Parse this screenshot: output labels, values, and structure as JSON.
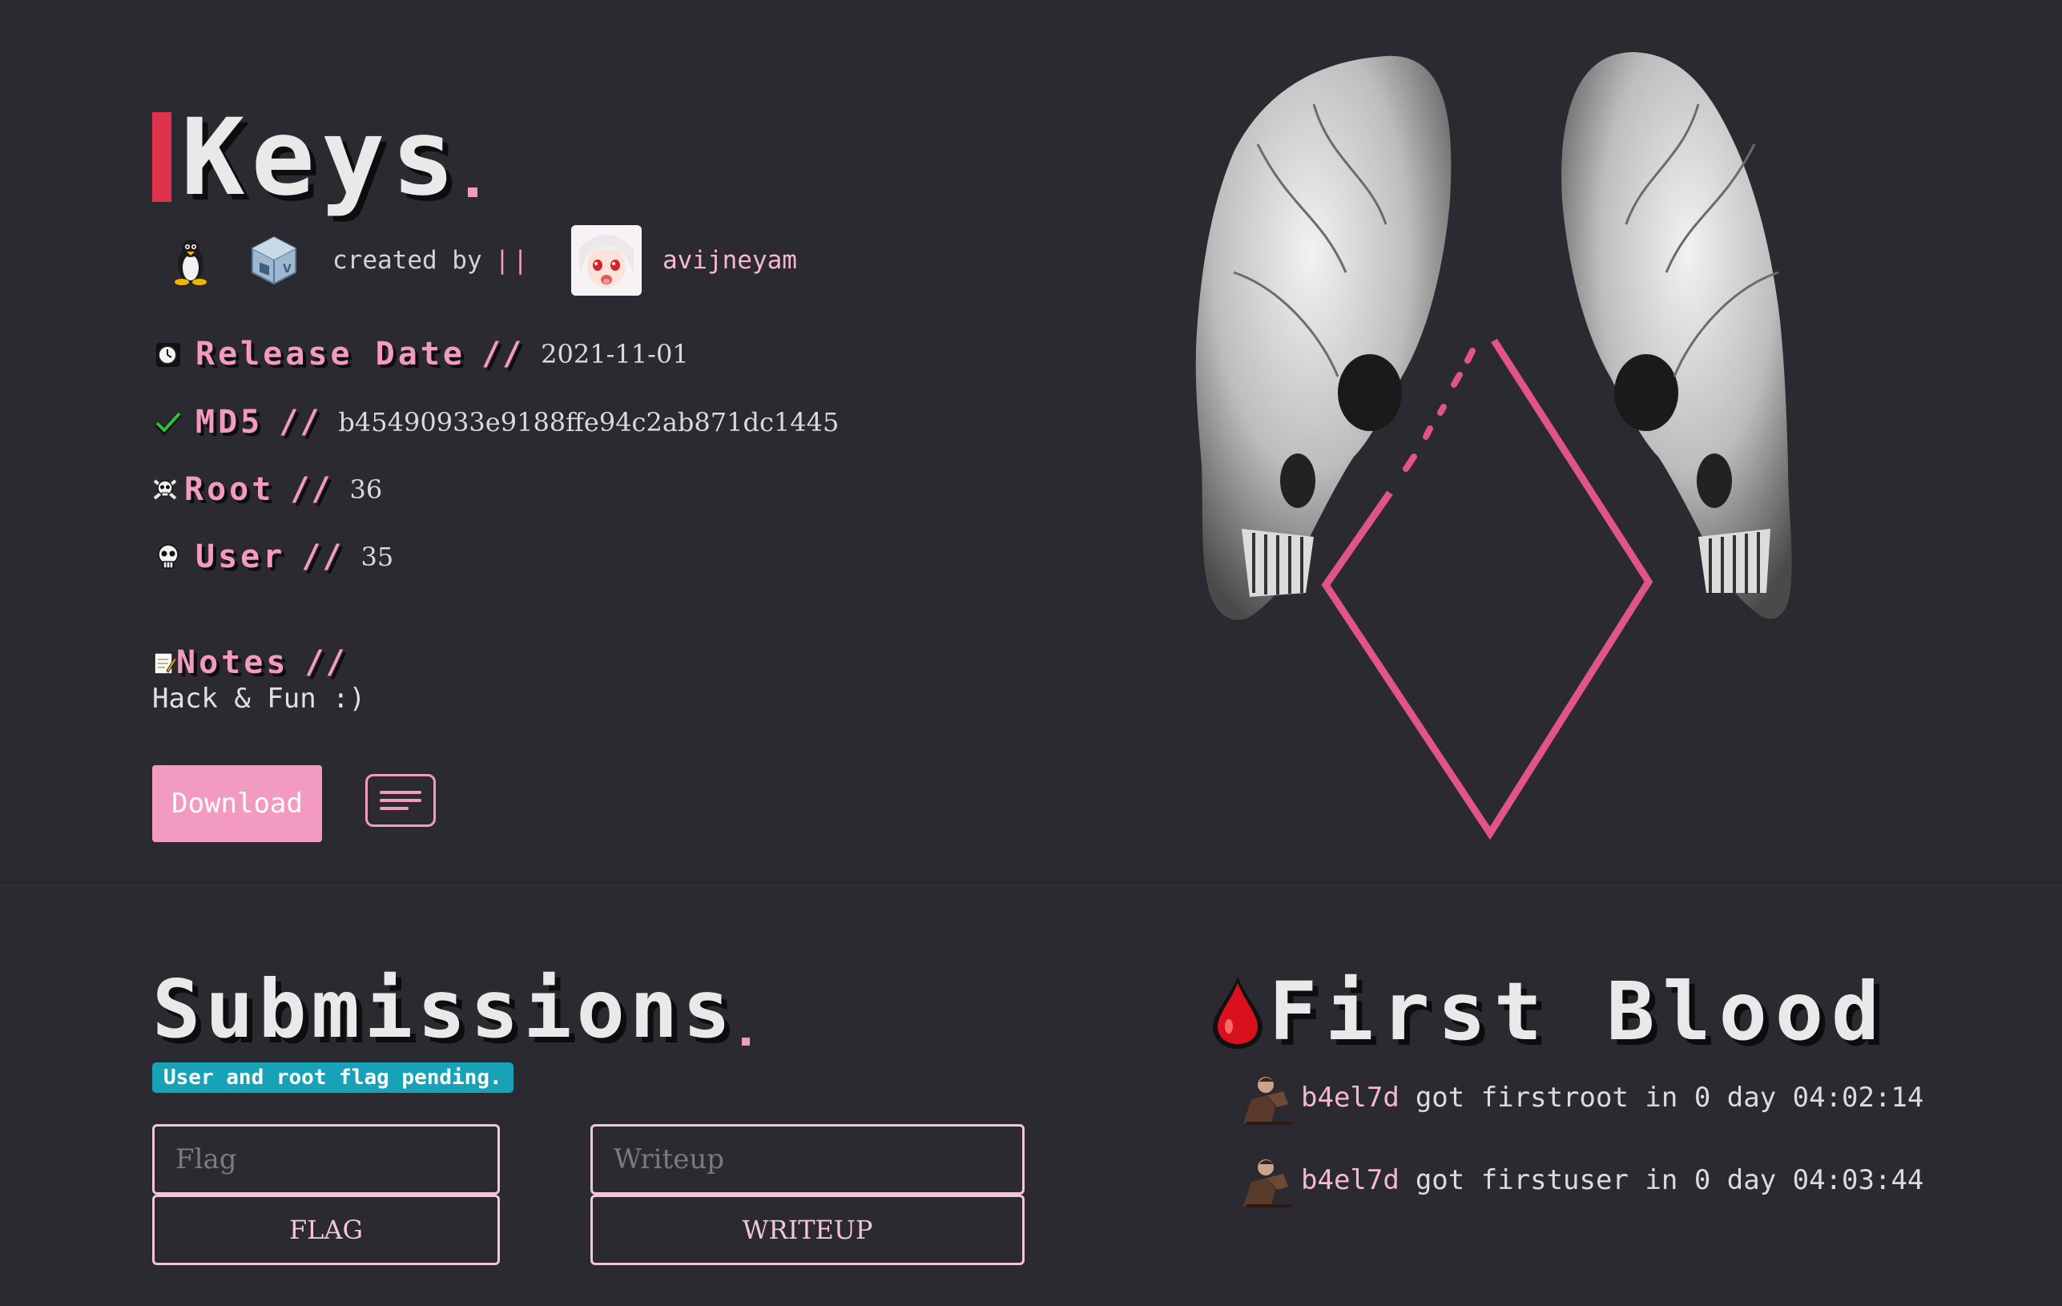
{
  "machine": {
    "title": "Keys",
    "created_by_label": "created by",
    "separator": "||",
    "creator": "avijneyam",
    "os_icons": [
      "linux-penguin-icon",
      "virtualbox-icon"
    ]
  },
  "meta": {
    "release": {
      "label": "Release Date",
      "slash": "//",
      "value": "2021-11-01",
      "icon": "clock-icon"
    },
    "md5": {
      "label": "MD5",
      "slash": "//",
      "value": "b45490933e9188ffe94c2ab871dc1445",
      "icon": "check-icon"
    },
    "root": {
      "label": "Root",
      "slash": "//",
      "value": "36",
      "icon": "skull-crossbones-icon"
    },
    "user": {
      "label": "User",
      "slash": "//",
      "value": "35",
      "icon": "skull-icon"
    },
    "notes": {
      "label": "Notes",
      "slash": "//",
      "value": "Hack & Fun :)",
      "icon": "memo-icon"
    }
  },
  "actions": {
    "download_label": "Download",
    "menu_icon": "menu-icon"
  },
  "submissions": {
    "title": "Submissions",
    "status": "User and root flag pending.",
    "flag_placeholder": "Flag",
    "flag_button": "FLAG",
    "writeup_placeholder": "Writeup",
    "writeup_button": "WRITEUP"
  },
  "first_blood": {
    "title": "First Blood",
    "entries": [
      {
        "user": "b4el7d",
        "text": "got firstroot in 0 day 04:02:14"
      },
      {
        "user": "b4el7d",
        "text": "got firstuser in 0 day 04:03:44"
      }
    ]
  },
  "colors": {
    "background": "#2b2a30",
    "accent_pink": "#f29abf",
    "title_bar_red": "#e0324a",
    "badge_teal": "#17a2b8"
  }
}
